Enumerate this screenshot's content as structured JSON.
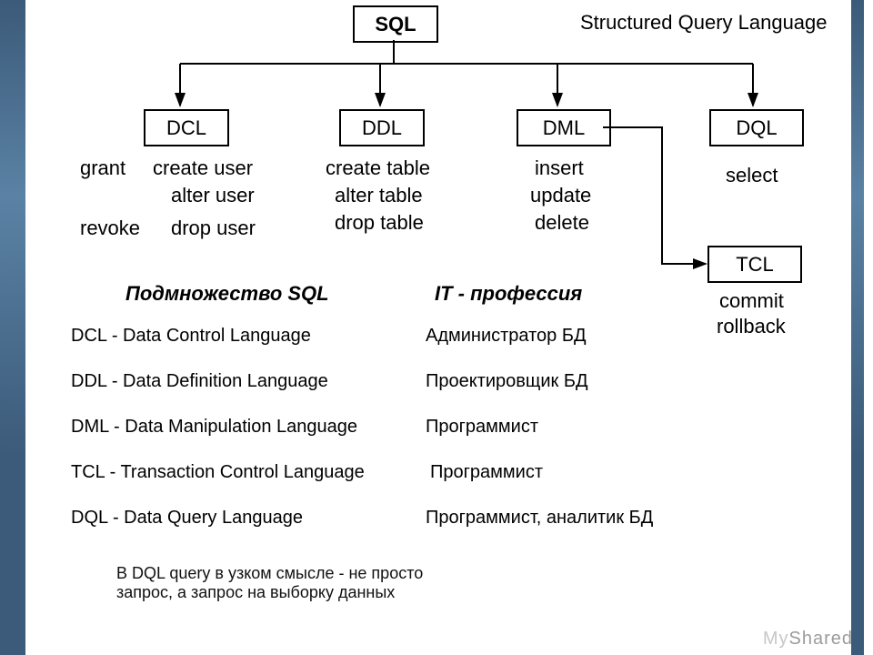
{
  "root": {
    "title": "SQL",
    "subtitle": "Structured Query Language"
  },
  "branches": {
    "dcl": {
      "label": "DCL",
      "commands": [
        "grant",
        "create user",
        "alter user",
        "revoke",
        "drop user"
      ]
    },
    "ddl": {
      "label": "DDL",
      "commands": [
        "create table",
        "alter table",
        "drop table"
      ]
    },
    "dml": {
      "label": "DML",
      "commands": [
        "insert",
        "update",
        "delete"
      ]
    },
    "dql": {
      "label": "DQL",
      "commands": [
        "select"
      ]
    },
    "tcl": {
      "label": "TCL",
      "commands": [
        "commit",
        "rollback"
      ]
    }
  },
  "definitions": {
    "heading": "Подмножество SQL",
    "items": [
      "DCL - Data Control Language",
      "DDL - Data Definition Language",
      "DML - Data Manipulation Language",
      "TCL - Transaction Control Language",
      "DQL - Data Query Language"
    ]
  },
  "profession": {
    "heading": "IT - профессия",
    "items": [
      "Администратор БД",
      "Проектировщик БД",
      "Программист",
      "Программист",
      "Программист, аналитик БД"
    ]
  },
  "footnote": "В DQL query в узком смысле - не просто\nзапрос, а запрос на выборку данных",
  "watermark": {
    "a": "My",
    "b": "Shared"
  }
}
